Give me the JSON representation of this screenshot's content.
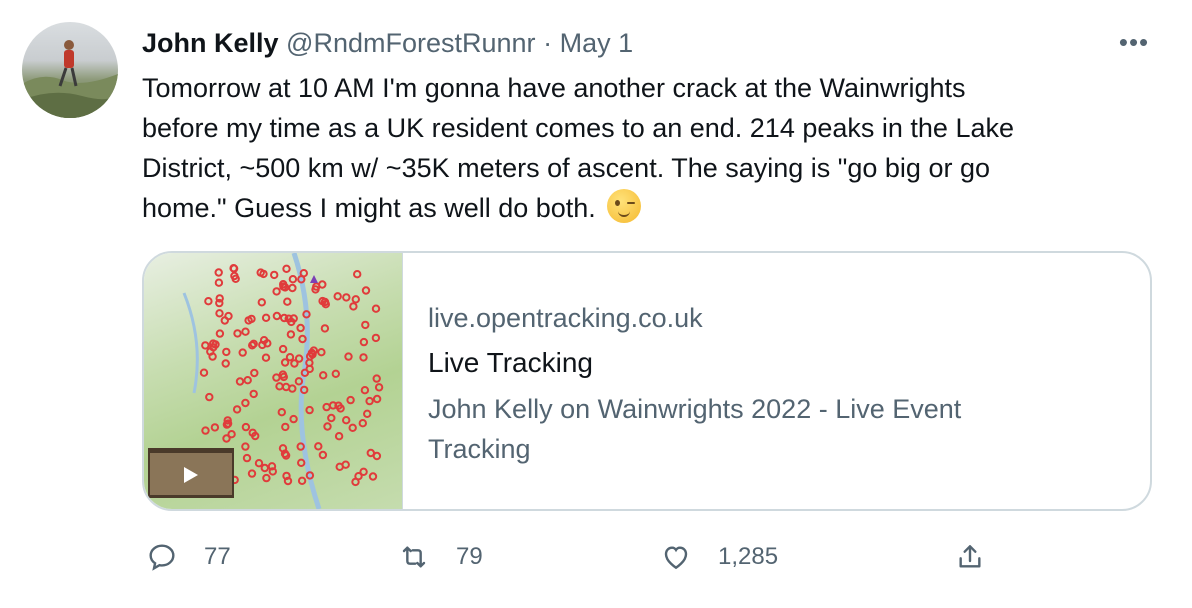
{
  "tweet": {
    "author_name": "John Kelly",
    "author_handle": "@RndmForestRunnr",
    "separator": "·",
    "date": "May 1",
    "more_label": "•••",
    "text_lines": [
      "Tomorrow at 10 AM I'm gonna have another crack at the Wainwrights",
      "before my time as a UK resident comes to an end. 214 peaks in the Lake",
      "District, ~500 km w/ ~35K meters of ascent. The saying is \"go big or go",
      "home.\" Guess I might as well do both."
    ],
    "emoji": "winking-face"
  },
  "card": {
    "domain": "live.opentracking.co.uk",
    "title": "Live Tracking",
    "description": "John Kelly on Wainwrights 2022 - Live Event Tracking"
  },
  "actions": {
    "replies": "77",
    "retweets": "79",
    "likes": "1,285"
  },
  "colors": {
    "text": "#0f1419",
    "secondary": "#536471",
    "border": "#cfd9de",
    "map_marker": "#e03b3b"
  }
}
